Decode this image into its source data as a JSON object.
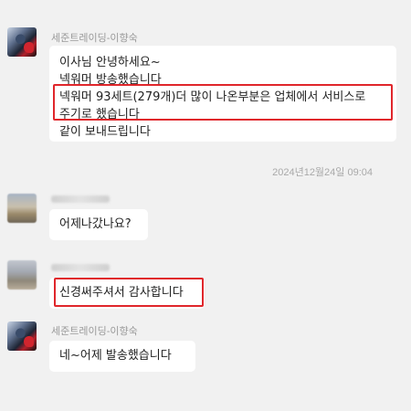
{
  "messages": [
    {
      "sender": "세준트레이딩-이향숙",
      "lines": [
        "이사님 안녕하세요~",
        "넥워머 방송했습니다",
        "넥워머 93세트(279개)더 많이 나온부분은 업체에서 서비스로",
        "주기로 했습니다",
        "같이 보내드립니다"
      ]
    },
    {
      "sender_visible": false,
      "text": "어제나갔나요?"
    },
    {
      "sender_visible": false,
      "text": "신경써주셔서 감사합니다"
    },
    {
      "sender": "세준트레이딩-이향숙",
      "text": "네~어제 발송했습니다"
    }
  ],
  "timestamp": "2024년12월24일 09:04",
  "colors": {
    "highlight": "#e0262b",
    "background": "#f1f1f1",
    "bubble": "#ffffff"
  }
}
